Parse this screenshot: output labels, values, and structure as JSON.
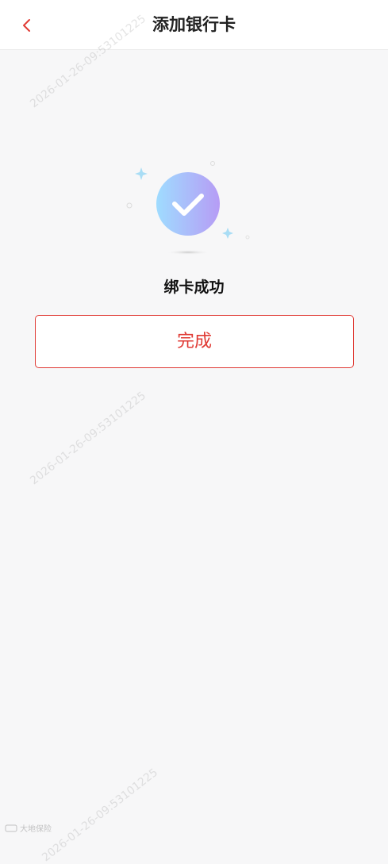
{
  "header": {
    "title": "添加银行卡"
  },
  "result": {
    "message": "绑卡成功",
    "done_label": "完成"
  },
  "watermark": {
    "text": "2026-01-26-09:53101225",
    "corner_text": "大地保险"
  },
  "colors": {
    "accent": "#e03a34",
    "check_gradient_start": "#9fdcff",
    "check_gradient_end": "#b69cf5"
  }
}
